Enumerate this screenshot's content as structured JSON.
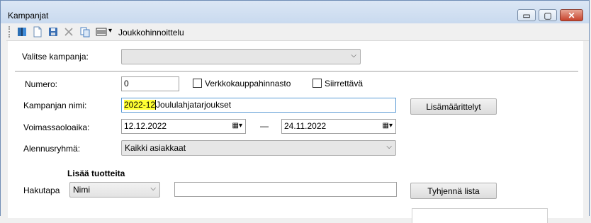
{
  "window": {
    "title": "Kampanjat",
    "controls": {
      "minimize": "▭",
      "maximize": "▢",
      "close": "✕"
    }
  },
  "toolbar": {
    "icons": [
      "open-book-icon",
      "new-document-icon",
      "save-icon",
      "delete-icon",
      "copy-icon",
      "barcode-icon"
    ],
    "dropdown_glyph": "▾",
    "group_pricing_label": "Joukkohinnoittelu"
  },
  "form": {
    "select_campaign": {
      "label": "Valitse kampanja:",
      "value": ""
    },
    "number": {
      "label": "Numero:",
      "value": "0"
    },
    "webshop_price": {
      "label": "Verkkokauppahinnasto",
      "checked": false
    },
    "transferable": {
      "label": "Siirrettävä",
      "checked": false
    },
    "campaign_name": {
      "label": "Kampanjan nimi:",
      "value_highlight": "2022-12",
      "value_rest": "Joululahjatarjoukset"
    },
    "extra_definitions_button": "Lisämäärittelyt",
    "validity": {
      "label": "Voimassaoloaika:",
      "start": "12.12.2022",
      "separator": "—",
      "end": "24.11.2022"
    },
    "discount_group": {
      "label": "Alennusryhmä:",
      "value": "Kaikki asiakkaat"
    },
    "add_products": {
      "heading": "Lisää tuotteita",
      "search_method_label": "Hakutapa",
      "search_method_value": "Nimi",
      "search_value": "",
      "clear_list_button": "Tyhjennä lista"
    }
  }
}
